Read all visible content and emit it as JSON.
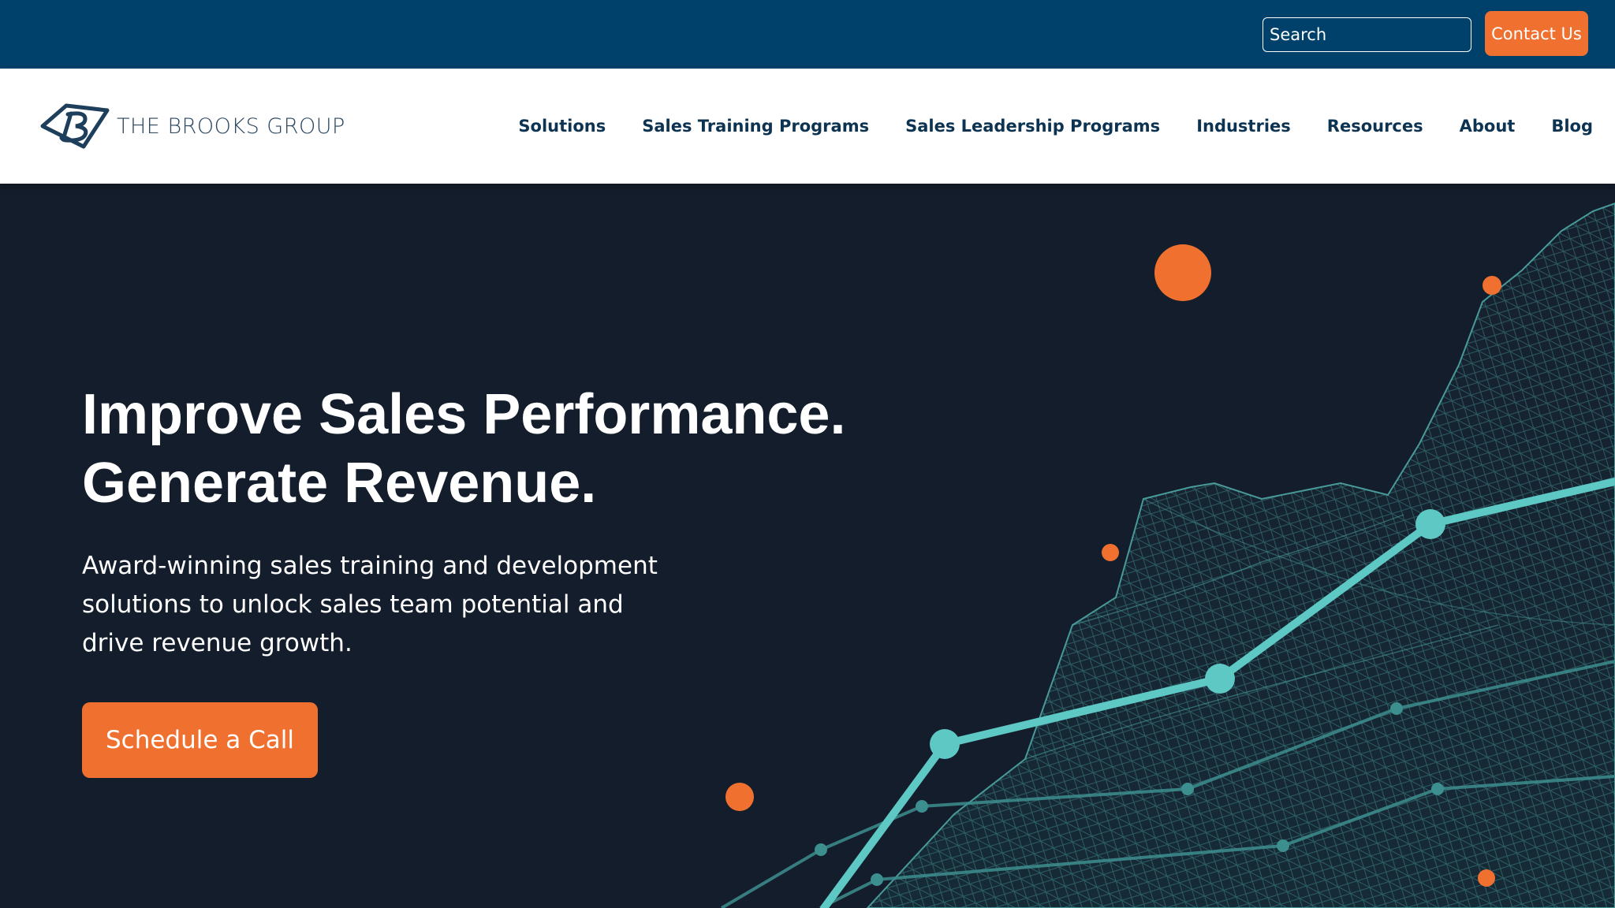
{
  "utility_bar": {
    "search_placeholder": "Search",
    "contact_label": "Contact Us"
  },
  "header": {
    "logo_text": "THE BROOKS GROUP",
    "nav": [
      {
        "label": "Solutions"
      },
      {
        "label": "Sales Training Programs"
      },
      {
        "label": "Sales Leadership Programs"
      },
      {
        "label": "Industries"
      },
      {
        "label": "Resources"
      },
      {
        "label": "About"
      },
      {
        "label": "Blog"
      }
    ]
  },
  "hero": {
    "title_line1": "Improve Sales Performance.",
    "title_line2": "Generate Revenue.",
    "subtitle": "Award-winning sales training and development solutions to unlock sales team potential and drive revenue growth.",
    "cta_label": "Schedule a Call"
  },
  "colors": {
    "utility_bar_bg": "#00416b",
    "accent_orange": "#f0702f",
    "hero_bg": "#141d2b",
    "teal": "#5ec8c4",
    "nav_text": "#0d3352"
  }
}
